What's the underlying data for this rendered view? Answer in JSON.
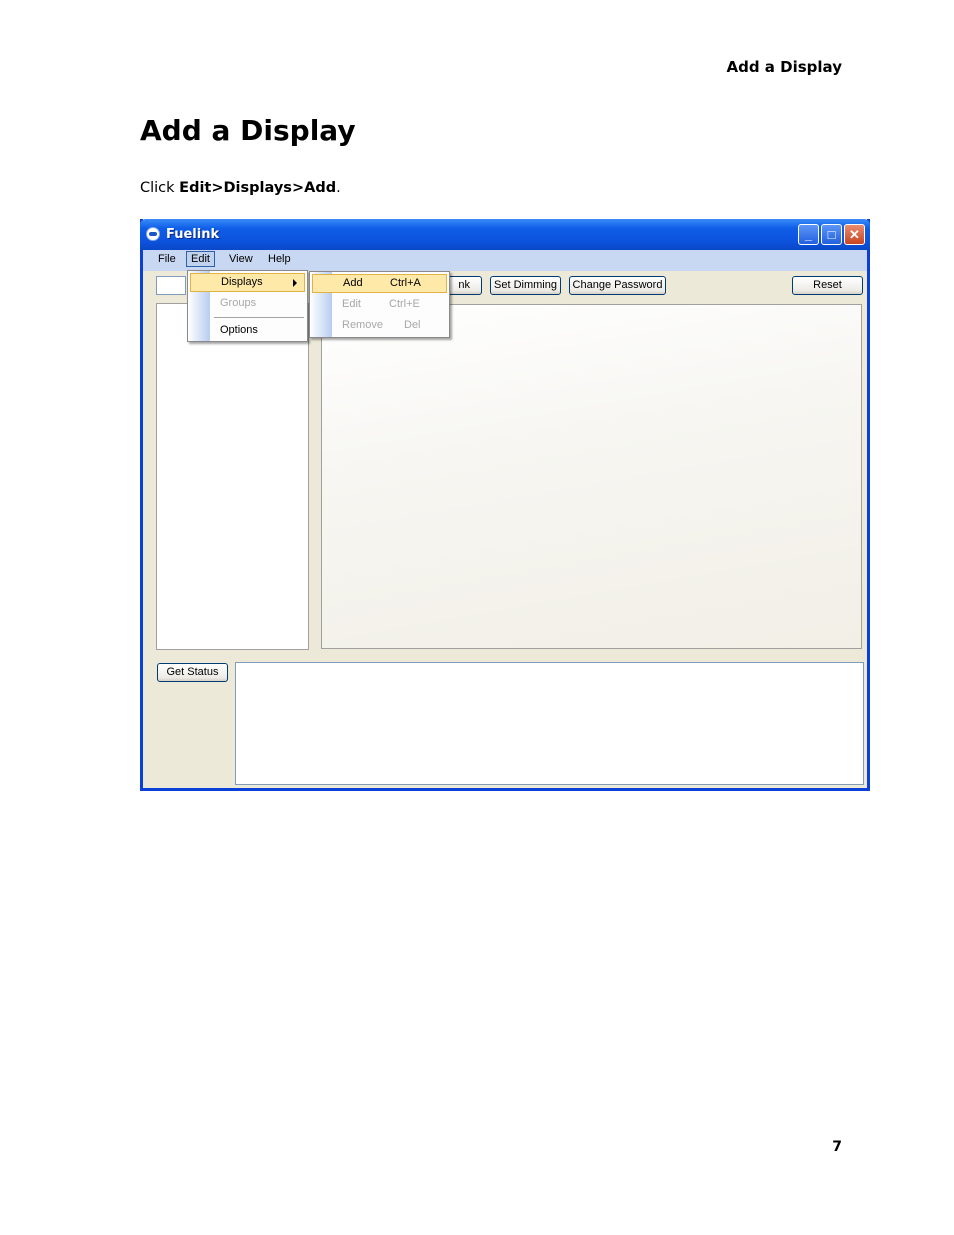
{
  "page": {
    "running_header": "Add a Display",
    "title": "Add a Display",
    "instruction": {
      "prefix": "Click ",
      "path_1": "Edit",
      "sep_1": ">",
      "path_2": "Displays",
      "sep_2": ">",
      "path_3": "Add",
      "suffix": "."
    },
    "page_number": "7"
  },
  "window": {
    "title": "Fuelink",
    "controls": {
      "minimize": "_",
      "maximize": "□",
      "close": "✕"
    },
    "menubar": [
      "File",
      "Edit",
      "View",
      "Help"
    ],
    "edit_menu": {
      "items": [
        {
          "label": "Displays",
          "state": "highlighted",
          "has_submenu": true
        },
        {
          "label": "Groups",
          "state": "disabled"
        },
        {
          "label": "Options",
          "state": "normal"
        }
      ]
    },
    "displays_submenu": {
      "items": [
        {
          "label": "Add",
          "shortcut": "Ctrl+A",
          "state": "highlighted"
        },
        {
          "label": "Edit",
          "shortcut": "Ctrl+E",
          "state": "disabled"
        },
        {
          "label": "Remove",
          "shortcut": "Del",
          "state": "disabled"
        }
      ]
    },
    "toolbar": {
      "partial_button": "nk",
      "set_dimming": "Set Dimming",
      "change_password": "Change Password",
      "reset": "Reset"
    },
    "get_status": "Get Status"
  },
  "colors": {
    "titlebar": "#0c53dd",
    "menu_highlight": "#ffe9a8",
    "window_bg": "#ece9d8",
    "window_border": "#0a3fd8"
  },
  "icons": [
    "app-icon",
    "minimize-icon",
    "maximize-icon",
    "close-icon",
    "submenu-arrow-icon"
  ]
}
